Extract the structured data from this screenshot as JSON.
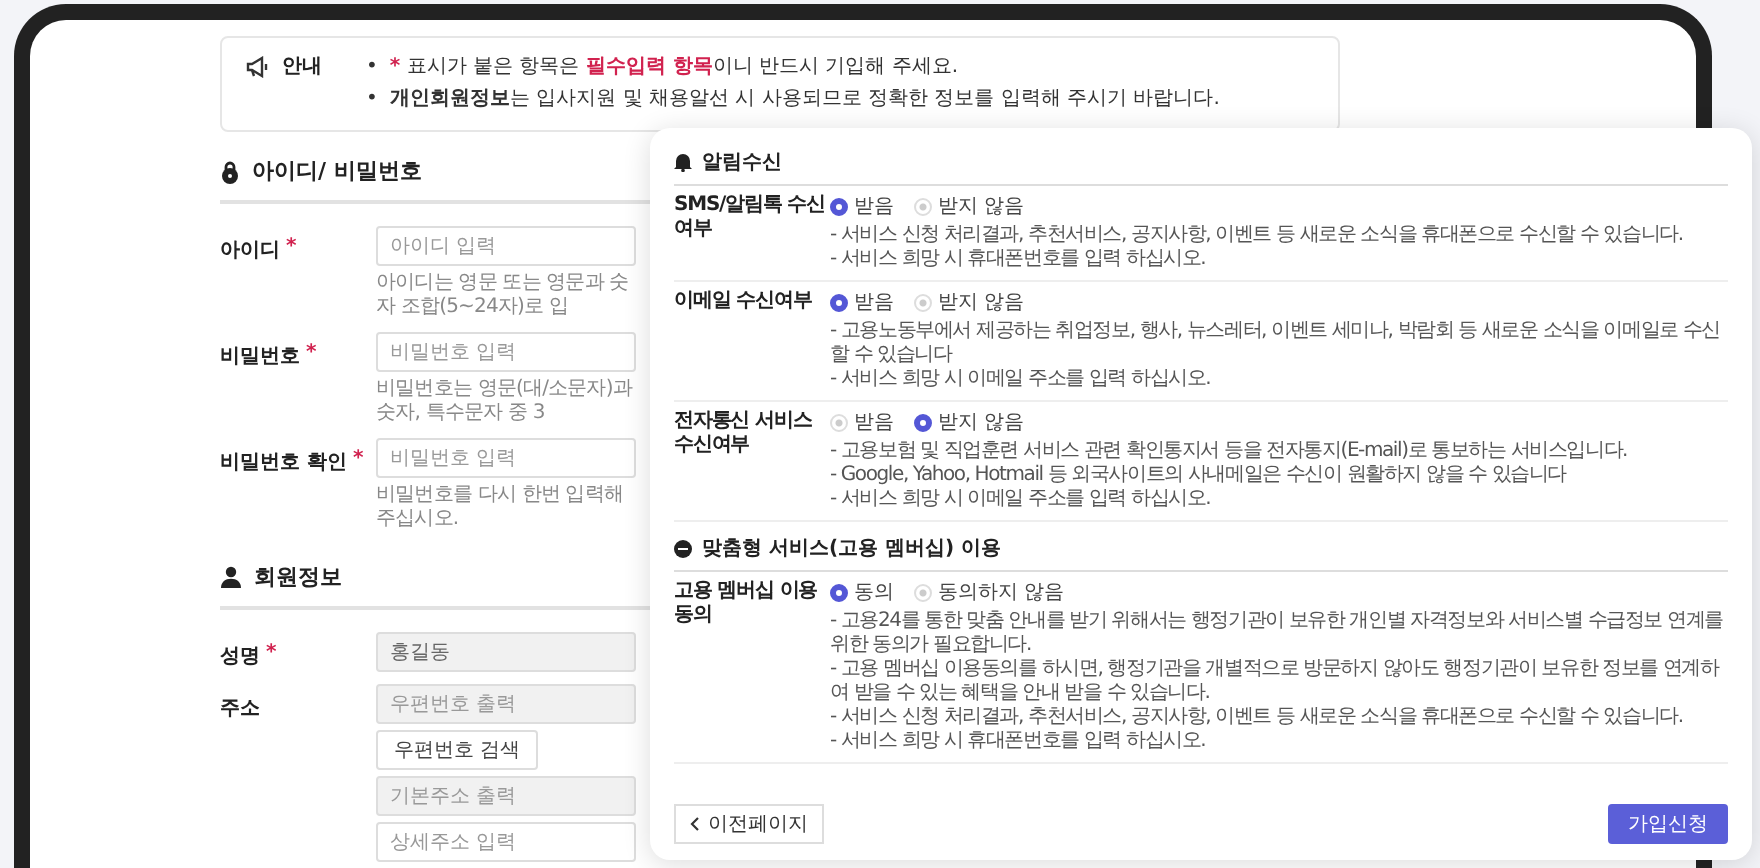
{
  "notice": {
    "label": "안내",
    "bullet": "•",
    "lines": [
      [
        {
          "kind": "mark",
          "text": "*"
        },
        {
          "kind": "plain",
          "text": " 표시가 붙은 항목은 "
        },
        {
          "kind": "accent",
          "text": "필수입력 항목"
        },
        {
          "kind": "plain",
          "text": "이니 반드시 기입해 주세요."
        }
      ],
      [
        {
          "kind": "strong",
          "text": "개인회원정보"
        },
        {
          "kind": "plain",
          "text": "는 입사지원 및 채용알선 시 사용되므로 정확한 정보를 입력해 주시기 바랍니다."
        }
      ]
    ]
  },
  "form_sections": [
    {
      "title": "아이디/ 비밀번호",
      "rows": [
        {
          "label": "아이디",
          "required": true,
          "inputs": [
            {
              "kind": "input",
              "placeholder": "아이디 입력",
              "disabled": false
            }
          ],
          "helper": "아이디는 영문 또는 영문과 숫자 조합(5~24자)로 입"
        },
        {
          "label": "비밀번호",
          "required": true,
          "inputs": [
            {
              "kind": "input",
              "placeholder": "비밀번호 입력",
              "disabled": false
            }
          ],
          "helper": "비밀번호는 영문(대/소문자)과 숫자, 특수문자 중 3"
        },
        {
          "label": "비밀번호 확인",
          "required": true,
          "inputs": [
            {
              "kind": "input",
              "placeholder": "비밀번호 입력",
              "disabled": false
            }
          ],
          "helper": "비밀번호를 다시 한번 입력해 주십시오."
        }
      ]
    },
    {
      "title": "회원정보",
      "rows": [
        {
          "label": "성명",
          "required": true,
          "inputs": [
            {
              "kind": "input",
              "value": "홍길동",
              "disabled": true
            }
          ]
        },
        {
          "label": "주소",
          "required": false,
          "inputs": [
            {
              "kind": "input",
              "placeholder": "우편번호 출력",
              "disabled": true
            },
            {
              "kind": "button",
              "label": "우편번호 검색"
            },
            {
              "kind": "input",
              "placeholder": "기본주소 출력",
              "disabled": true
            },
            {
              "kind": "input",
              "placeholder": "상세주소 입력",
              "disabled": false
            }
          ]
        }
      ]
    }
  ],
  "consent": {
    "sections": [
      {
        "title": "알림수신",
        "rows": [
          {
            "label": "SMS/알림톡 수신여부",
            "options": [
              {
                "label": "받음",
                "selected": true
              },
              {
                "label": "받지 않음",
                "selected": false
              }
            ],
            "notes": [
              "- 서비스 신청 처리결과, 추천서비스, 공지사항, 이벤트 등 새로운 소식을 휴대폰으로 수신할 수 있습니다.",
              "- 서비스 희망 시 휴대폰번호를 입력 하십시오."
            ]
          },
          {
            "label": "이메일 수신여부",
            "options": [
              {
                "label": "받음",
                "selected": true
              },
              {
                "label": "받지 않음",
                "selected": false
              }
            ],
            "notes": [
              "- 고용노동부에서 제공하는 취업정보, 행사, 뉴스레터, 이벤트 세미나, 박람회 등 새로운 소식을 이메일로 수신할 수 있습니다",
              "- 서비스 희망 시 이메일 주소를 입력 하십시오."
            ]
          },
          {
            "label": "전자통신 서비스 수신여부",
            "options": [
              {
                "label": "받음",
                "selected": false
              },
              {
                "label": "받지 않음",
                "selected": true
              }
            ],
            "notes": [
              "- 고용보험 및 직업훈련 서비스 관련 확인통지서 등을 전자통지(E-mail)로 통보하는 서비스입니다.",
              "- Google, Yahoo, Hotmail 등 외국사이트의 사내메일은 수신이 원활하지 않을 수 있습니다",
              "- 서비스 희망 시 이메일 주소를 입력 하십시오."
            ]
          }
        ]
      },
      {
        "title": "맞춤형 서비스(고용 멤버십) 이용",
        "rows": [
          {
            "label": "고용 멤버십 이용 동의",
            "options": [
              {
                "label": "동의",
                "selected": true
              },
              {
                "label": "동의하지 않음",
                "selected": false
              }
            ],
            "notes": [
              "- 고용24를 통한 맞춤 안내를 받기 위해서는 행정기관이 보유한 개인별 자격정보와 서비스별 수급정보 연계를 위한 동의가 필요합니다.",
              "- 고용 멤버십 이용동의를 하시면, 행정기관을 개별적으로 방문하지 않아도 행정기관이 보유한 정보를 연계하여 받을 수 있는 혜택을 안내 받을 수 있습니다.",
              "- 서비스 신청 처리결과, 추천서비스, 공지사항, 이벤트 등 새로운 소식을 휴대폰으로 수신할 수 있습니다.",
              "- 서비스 희망 시 휴대폰번호를 입력 하십시오."
            ]
          }
        ]
      }
    ],
    "prev_button": "이전페이지",
    "submit_button": "가입신청"
  }
}
